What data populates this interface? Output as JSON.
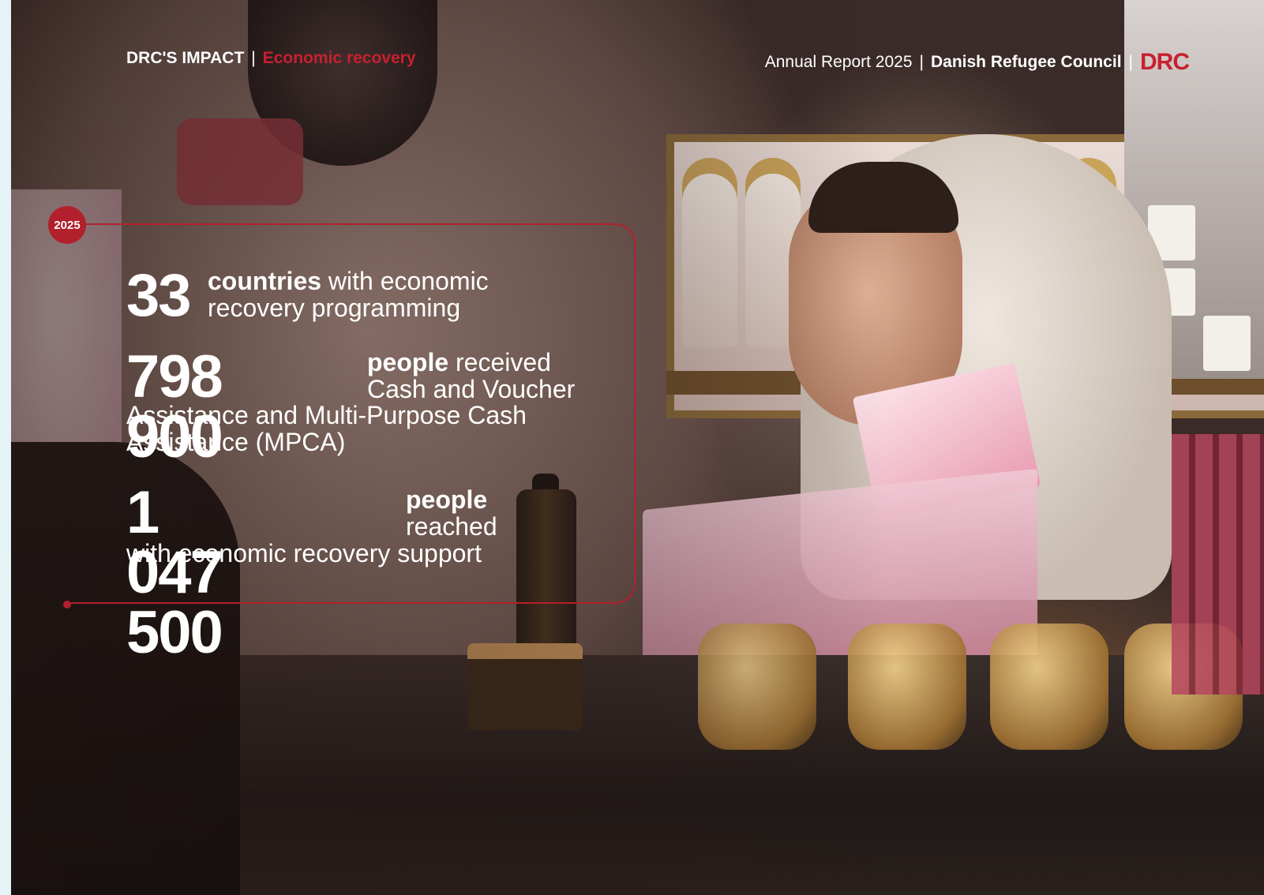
{
  "header": {
    "section": "DRC'S IMPACT",
    "topic": "Economic recovery",
    "report": "Annual Report 2025",
    "organization": "Danish Refugee Council",
    "logo_text": "DRC"
  },
  "year_badge": "2025",
  "stats": [
    {
      "number": "33",
      "bold": "countries",
      "text": " with economic recovery programming"
    },
    {
      "number": "798 900",
      "bold": "people",
      "text_line1": " received Cash and Voucher",
      "text_line2": "Assistance and Multi-Purpose Cash Assistance (MPCA)"
    },
    {
      "number": "1 047 500",
      "bold": "people",
      "text_line1": "reached",
      "text_line2": "with economic recovery support"
    }
  ],
  "colors": {
    "accent": "#b3202d",
    "text": "#ffffff"
  }
}
